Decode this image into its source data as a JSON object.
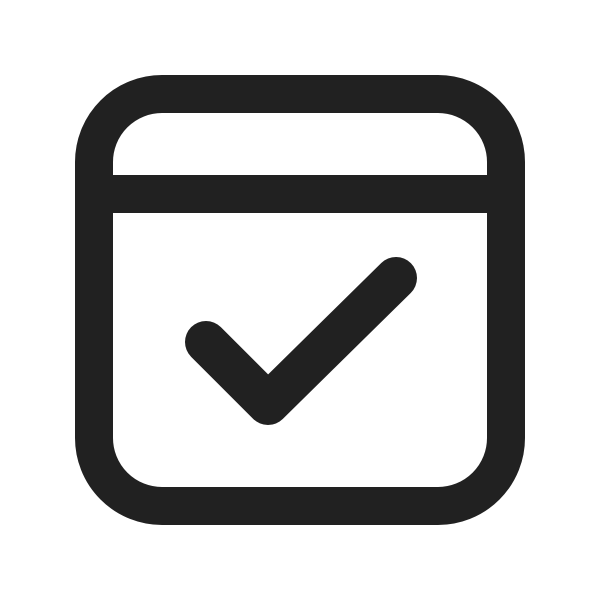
{
  "icon": {
    "name": "calendar-check-icon",
    "stroke_color": "#212121",
    "background_color": "#ffffff"
  }
}
